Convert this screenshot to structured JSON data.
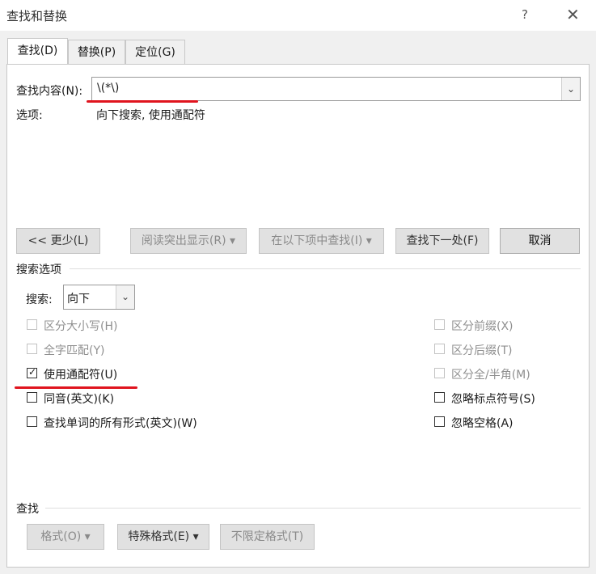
{
  "window": {
    "title": "查找和替换",
    "help": "?",
    "close": "✕"
  },
  "tabs": [
    {
      "label": "查找(D)"
    },
    {
      "label": "替换(P)"
    },
    {
      "label": "定位(G)"
    }
  ],
  "find": {
    "label": "查找内容(N):",
    "value": "\\(*\\)",
    "options_label": "选项:",
    "options_value": "向下搜索, 使用通配符"
  },
  "buttons": {
    "less": "<< 更少(L)",
    "highlight": "阅读突出显示(R) ▾",
    "find_in": "在以下项中查找(I) ▾",
    "find_next": "查找下一处(F)",
    "cancel": "取消"
  },
  "search_options": {
    "section_label": "搜索选项",
    "search_label": "搜索:",
    "search_value": "向下",
    "left": [
      {
        "label": "区分大小写(H)",
        "checked": false,
        "enabled": false
      },
      {
        "label": "全字匹配(Y)",
        "checked": false,
        "enabled": false
      },
      {
        "label": "使用通配符(U)",
        "checked": true,
        "enabled": true
      },
      {
        "label": "同音(英文)(K)",
        "checked": false,
        "enabled": true
      },
      {
        "label": "查找单词的所有形式(英文)(W)",
        "checked": false,
        "enabled": true
      }
    ],
    "right": [
      {
        "label": "区分前缀(X)",
        "checked": false,
        "enabled": false
      },
      {
        "label": "区分后缀(T)",
        "checked": false,
        "enabled": false
      },
      {
        "label": "区分全/半角(M)",
        "checked": false,
        "enabled": false
      },
      {
        "label": "忽略标点符号(S)",
        "checked": false,
        "enabled": true
      },
      {
        "label": "忽略空格(A)",
        "checked": false,
        "enabled": true
      }
    ]
  },
  "find_section": {
    "label": "查找",
    "format": "格式(O) ▾",
    "special": "特殊格式(E) ▾",
    "no_format": "不限定格式(T)"
  },
  "colors": {
    "annotation_red": "#e0141e"
  }
}
